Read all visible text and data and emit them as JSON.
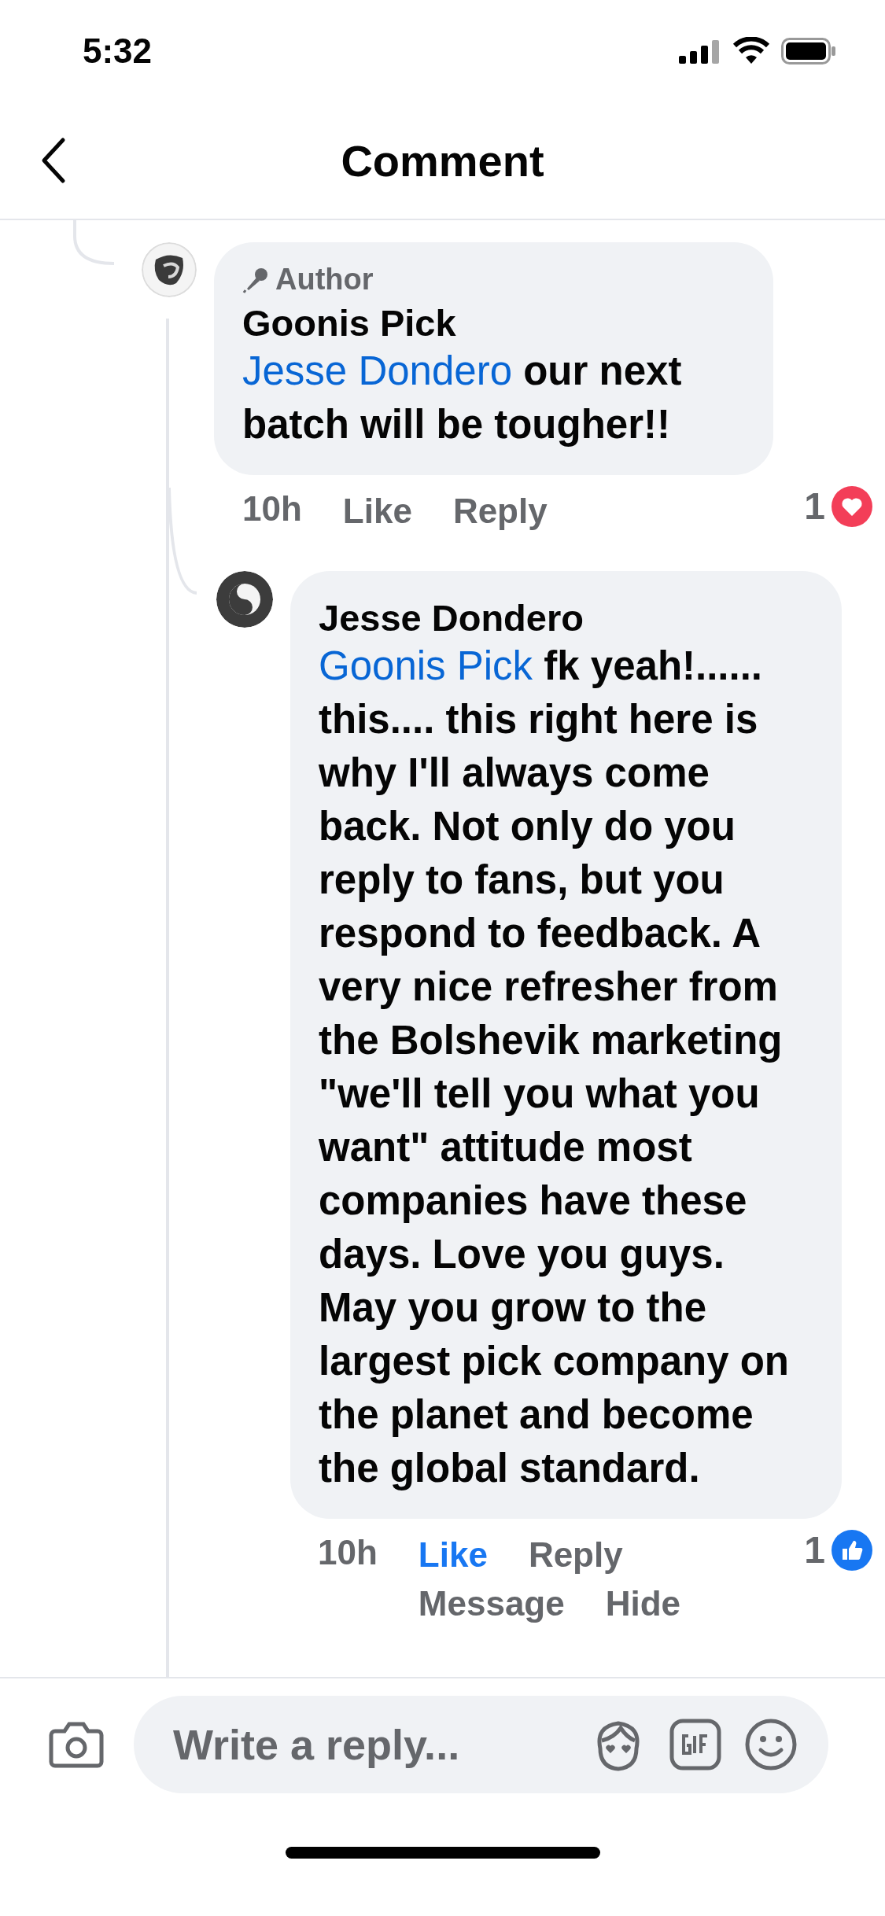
{
  "status_bar": {
    "time": "5:32"
  },
  "header": {
    "title": "Comment"
  },
  "comments": [
    {
      "badge": "Author",
      "author": "Goonis Pick",
      "mention": "Jesse Dondero",
      "text": "our next batch will be tougher!!",
      "time": "10h",
      "liked": false,
      "actions": [
        "Like",
        "Reply"
      ],
      "reaction": {
        "count": "1",
        "kind": "love"
      }
    },
    {
      "author": "Jesse Dondero",
      "mention": "Goonis Pick",
      "text": "fk yeah!...... this.... this right here is why I'll always come back. Not only do you reply to fans, but you respond to feedback. A very nice refresher from the Bolshevik marketing \"we'll tell you what you want\" attitude most companies have these days. Love you guys. May you grow to the largest pick company on the planet and become the global standard.",
      "time": "10h",
      "liked": true,
      "actions": [
        "Like",
        "Reply",
        "Message",
        "Hide"
      ],
      "reaction": {
        "count": "1",
        "kind": "like"
      }
    }
  ],
  "composer": {
    "placeholder": "Write a reply..."
  }
}
